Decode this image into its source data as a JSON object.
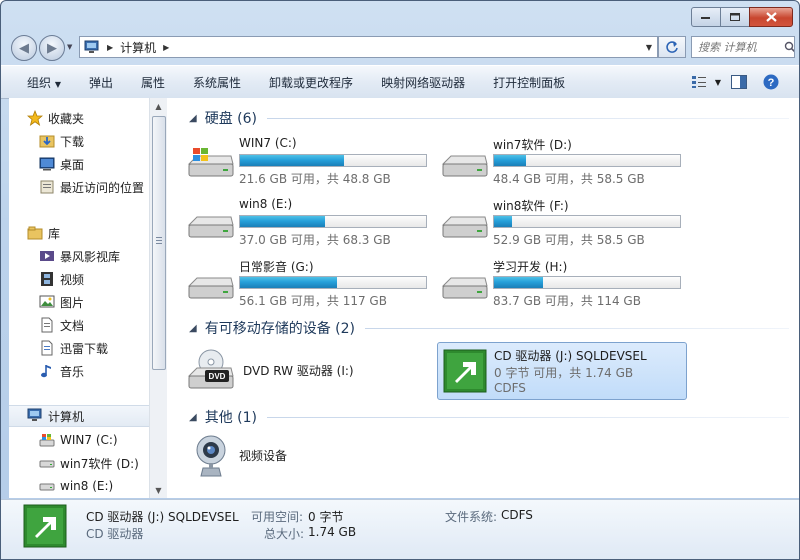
{
  "window": {
    "title": "计算机"
  },
  "address": {
    "location": "计算机",
    "search_placeholder": "搜索 计算机"
  },
  "toolbar": {
    "items": [
      "组织",
      "弹出",
      "属性",
      "系统属性",
      "卸载或更改程序",
      "映射网络驱动器",
      "打开控制面板"
    ]
  },
  "nav": {
    "favorites": {
      "label": "收藏夹",
      "items": [
        "下载",
        "桌面",
        "最近访问的位置"
      ]
    },
    "library": {
      "label": "库",
      "items": [
        "暴风影视库",
        "视频",
        "图片",
        "文档",
        "迅雷下载",
        "音乐"
      ]
    },
    "computer": {
      "label": "计算机",
      "items": [
        "WIN7 (C:)",
        "win7软件 (D:)",
        "win8 (E:)"
      ]
    }
  },
  "groups": {
    "hard_disks": "硬盘 (6)",
    "removable": "有可移动存储的设备 (2)",
    "other": "其他 (1)"
  },
  "drives": [
    {
      "name": "WIN7 (C:)",
      "meta": "21.6 GB 可用，共 48.8 GB",
      "used": 0.557
    },
    {
      "name": "win7软件 (D:)",
      "meta": "48.4 GB 可用，共 58.5 GB",
      "used": 0.173
    },
    {
      "name": "win8 (E:)",
      "meta": "37.0 GB 可用，共 68.3 GB",
      "used": 0.458
    },
    {
      "name": "win8软件 (F:)",
      "meta": "52.9 GB 可用，共 58.5 GB",
      "used": 0.096
    },
    {
      "name": "日常影音 (G:)",
      "meta": "56.1 GB 可用，共 117 GB",
      "used": 0.521
    },
    {
      "name": "学习开发 (H:)",
      "meta": "83.7 GB 可用，共 114 GB",
      "used": 0.266
    }
  ],
  "removable": {
    "dvd": {
      "name": "DVD RW 驱动器 (I:)",
      "badge": "DVD"
    },
    "cd": {
      "name": "CD 驱动器 (J:) SQLDEVSEL",
      "meta": "0 字节 可用，共 1.74 GB",
      "fs": "CDFS"
    }
  },
  "other": {
    "camera": "视频设备"
  },
  "details": {
    "title": "CD 驱动器 (J:) SQLDEVSEL",
    "subtitle": "CD 驱动器",
    "free_label": "可用空间:",
    "free_value": "0 字节",
    "total_label": "总大小:",
    "total_value": "1.74 GB",
    "fs_label": "文件系统:",
    "fs_value": "CDFS"
  }
}
